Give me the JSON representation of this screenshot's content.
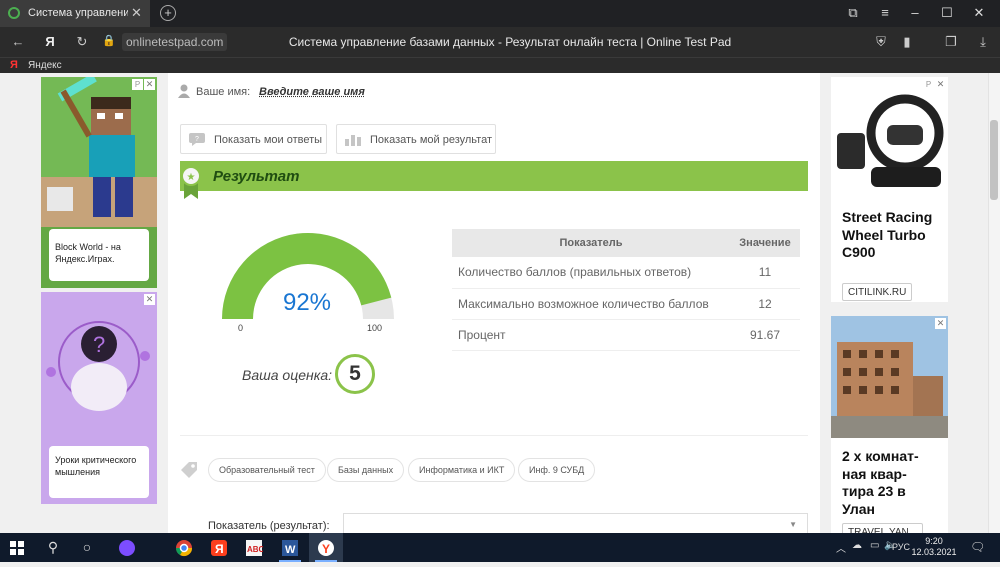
{
  "browser": {
    "tab_title": "Система управление ба",
    "url": "onlinetestpad.com",
    "page_title": "Система управление базами данных - Результат онлайн теста | Online Test Pad",
    "bookmark_label": "Яндекс"
  },
  "left_ads": {
    "ad1_text": "Block World - на Яндекс.Играх.",
    "ad1_marker": "P",
    "ad2_text": "Уроки критического мышления"
  },
  "main": {
    "username_label": "Ваше имя:",
    "username_value": "Введите ваше имя",
    "show_answers_label": "Показать мои ответы",
    "show_result_label": "Показать мой результат",
    "result_title": "Результат",
    "gauge": {
      "percent_text": "92%",
      "value": 92,
      "min_label": "0",
      "max_label": "100"
    },
    "grade_label": "Ваша оценка:",
    "grade_value": "5",
    "table": {
      "headers": [
        "Показатель",
        "Значение"
      ],
      "rows": [
        [
          "Количество баллов (правильных ответов)",
          "11"
        ],
        [
          "Максимально возможное количество баллов",
          "12"
        ],
        [
          "Процент",
          "91.67"
        ]
      ]
    },
    "tags": [
      "Образовательный тест",
      "Базы данных",
      "Информатика и ИКТ",
      "Инф. 9 СУБД"
    ],
    "indicator_label": "Показатель (результат):"
  },
  "right_ads": {
    "ad1_product": "Street Racing Wheel Turbo C900",
    "ad1_shop": "CITILINK.RU",
    "ad1_marker": "P",
    "ad2_product": "2 х комнат- ная квар- тира 23 в Улан",
    "ad2_shop": "TRAVEL.YAN..."
  },
  "taskbar": {
    "language": "РУС",
    "time": "9:20",
    "date": "12.03.2021"
  },
  "colors": {
    "accent_green": "#8bc34a",
    "gauge_fill": "#7cc242",
    "percent_blue": "#1976d2"
  }
}
